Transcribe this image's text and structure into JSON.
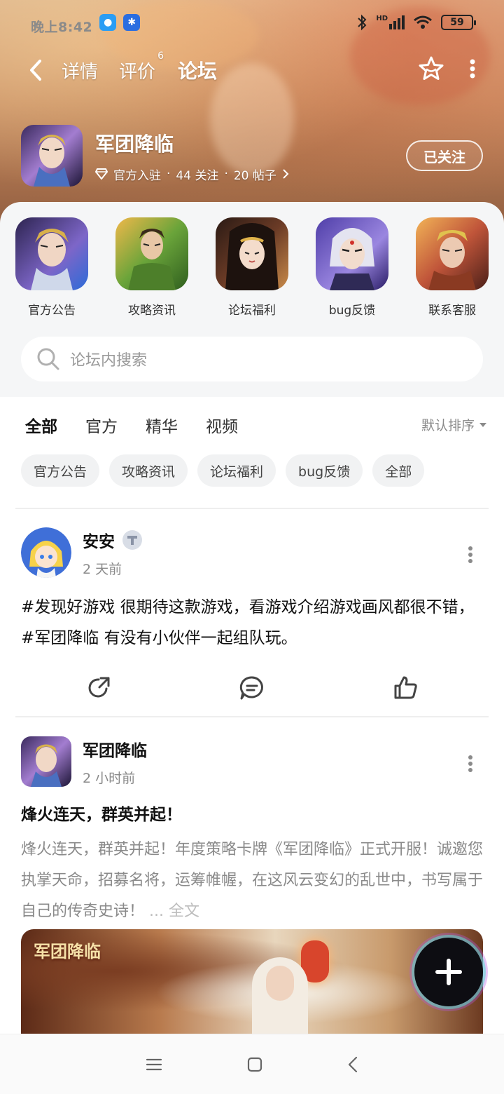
{
  "status_bar": {
    "time": "晚上8:42",
    "hd_label": "HD",
    "battery": "59"
  },
  "nav": {
    "tabs": [
      {
        "label": "详情"
      },
      {
        "label": "评价",
        "badge": "6"
      },
      {
        "label": "论坛"
      }
    ],
    "active_tab": "论坛"
  },
  "game": {
    "title": "军团降临",
    "official": "官方入驻",
    "followers": "44 关注",
    "posts": "20 帖子",
    "follow_label": "已关注"
  },
  "categories": [
    {
      "label": "官方公告"
    },
    {
      "label": "攻略资讯"
    },
    {
      "label": "论坛福利"
    },
    {
      "label": "bug反馈"
    },
    {
      "label": "联系客服"
    }
  ],
  "search": {
    "placeholder": "论坛内搜索"
  },
  "feed_tabs": {
    "tabs": [
      "全部",
      "官方",
      "精华",
      "视频"
    ],
    "active": "全部",
    "sort_label": "默认排序"
  },
  "filter_chips": [
    "官方公告",
    "攻略资讯",
    "论坛福利",
    "bug反馈",
    "全部"
  ],
  "posts": [
    {
      "author": "安安",
      "time": "2 天前",
      "body": "#发现好游戏 很期待这款游戏，看游戏介绍游戏画风都很不错，#军团降临 有没有小伙伴一起组队玩。"
    },
    {
      "author": "军团降临",
      "time": "2 小时前",
      "title": "烽火连天，群英并起！",
      "desc": "烽火连天，群英并起！年度策略卡牌《军团降临》正式开服！诚邀您执掌天命，招募名将，运筹帷幄，在这风云变幻的乱世中，书写属于自己的传奇史诗！",
      "more": "... 全文",
      "image_label": "军团降临"
    }
  ],
  "colors": {
    "accent": "#2fd3c4",
    "muted_text": "#8a8a8a",
    "chip_bg": "#f1f2f3",
    "sheet_bg": "#f5f6f7"
  }
}
